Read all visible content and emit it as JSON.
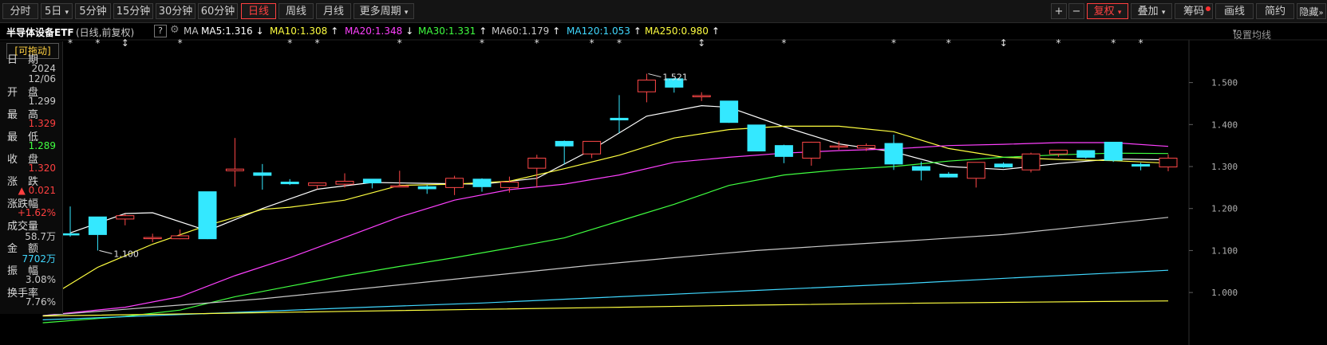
{
  "toolbar": {
    "periods": [
      "分时",
      "5日",
      "5分钟",
      "15分钟",
      "30分钟",
      "60分钟",
      "日线",
      "周线",
      "月线",
      "更多周期"
    ],
    "active_period": "日线",
    "right_buttons": [
      "复权",
      "叠加",
      "筹码",
      "画线",
      "简约",
      "隐藏"
    ],
    "plus": "+",
    "minus": "−",
    "dropdown_icon": "caret-down-icon",
    "hide_icon": "double-chevron-right-icon"
  },
  "header": {
    "name": "半导体设备ETF",
    "mode": "(日线,前复权)",
    "help": "?",
    "ma_label": "MA",
    "settings_link": "设置均线",
    "ma_items": [
      {
        "text": "MA5:1.316",
        "arrow": "↓",
        "color": "#ffffff"
      },
      {
        "text": "MA10:1.308",
        "arrow": "↑",
        "color": "#ffff40"
      },
      {
        "text": "MA20:1.348",
        "arrow": "↓",
        "color": "#ff40ff"
      },
      {
        "text": "MA30:1.331",
        "arrow": "↑",
        "color": "#40ff40"
      },
      {
        "text": "MA60:1.179",
        "arrow": "↑",
        "color": "#c8c8c8"
      },
      {
        "text": "MA120:1.053",
        "arrow": "↑",
        "color": "#40d8ff"
      },
      {
        "text": "MA250:0.980",
        "arrow": "↑",
        "color": "#ffff40"
      }
    ]
  },
  "panel": {
    "header": "[可拖动]",
    "rows": [
      {
        "label": "日　期",
        "value": "2024",
        "color": "#c8c8c8"
      },
      {
        "label": "",
        "value": "12/06",
        "color": "#c8c8c8"
      },
      {
        "label": "开　盘",
        "value": "1.299",
        "color": "#c8c8c8"
      },
      {
        "label": "最　高",
        "value": "1.329",
        "color": "#ff4040"
      },
      {
        "label": "最　低",
        "value": "1.289",
        "color": "#40ff40"
      },
      {
        "label": "收　盘",
        "value": "1.320",
        "color": "#ff4040"
      },
      {
        "label": "涨　跌",
        "value": "▲ 0.021",
        "color": "#ff4040"
      },
      {
        "label": "涨跌幅",
        "value": "+1.62%",
        "color": "#ff4040"
      },
      {
        "label": "成交量",
        "value": "58.7万",
        "color": "#c8c8c8"
      },
      {
        "label": "金　额",
        "value": "7702万",
        "color": "#40d8ff"
      },
      {
        "label": "振　幅",
        "value": "3.08%",
        "color": "#c8c8c8"
      },
      {
        "label": "换手率",
        "value": "7.76%",
        "color": "#c8c8c8"
      }
    ]
  },
  "chart_data": {
    "type": "candlestick",
    "ylim": [
      0.93,
      1.56
    ],
    "yticks": [
      "1.500",
      "1.400",
      "1.300",
      "1.200",
      "1.100",
      "1.000"
    ],
    "ytick_values": [
      1.5,
      1.4,
      1.3,
      1.2,
      1.1,
      1.0
    ],
    "annotations": [
      {
        "text": "1.521",
        "index": 21,
        "value": 1.521
      },
      {
        "text": "1.100",
        "index": 1,
        "value": 1.1
      }
    ],
    "markers": [
      "*",
      "*",
      "↕",
      "*",
      "*",
      "*",
      "*",
      "*",
      "*",
      "*",
      "*",
      "↕",
      "*",
      "*",
      "*",
      "↕",
      "*",
      "*",
      "*"
    ],
    "marker_indices": [
      0,
      1,
      2,
      4,
      8,
      9,
      12,
      15,
      17,
      19,
      20,
      23,
      26,
      30,
      32,
      34,
      36,
      38,
      39
    ],
    "candles": [
      {
        "o": 1.14,
        "h": 1.205,
        "l": 1.133,
        "c": 1.137
      },
      {
        "o": 1.18,
        "h": 1.18,
        "l": 1.1,
        "c": 1.138
      },
      {
        "o": 1.175,
        "h": 1.187,
        "l": 1.16,
        "c": 1.183
      },
      {
        "o": 1.131,
        "h": 1.14,
        "l": 1.12,
        "c": 1.131
      },
      {
        "o": 1.128,
        "h": 1.15,
        "l": 1.127,
        "c": 1.135
      },
      {
        "o": 1.24,
        "h": 1.24,
        "l": 1.127,
        "c": 1.128
      },
      {
        "o": 1.29,
        "h": 1.368,
        "l": 1.252,
        "c": 1.294
      },
      {
        "o": 1.285,
        "h": 1.306,
        "l": 1.245,
        "c": 1.279
      },
      {
        "o": 1.263,
        "h": 1.27,
        "l": 1.256,
        "c": 1.259
      },
      {
        "o": 1.255,
        "h": 1.262,
        "l": 1.246,
        "c": 1.261
      },
      {
        "o": 1.258,
        "h": 1.284,
        "l": 1.25,
        "c": 1.265
      },
      {
        "o": 1.27,
        "h": 1.27,
        "l": 1.248,
        "c": 1.261
      },
      {
        "o": 1.254,
        "h": 1.29,
        "l": 1.251,
        "c": 1.254
      },
      {
        "o": 1.252,
        "h": 1.256,
        "l": 1.235,
        "c": 1.247
      },
      {
        "o": 1.25,
        "h": 1.278,
        "l": 1.232,
        "c": 1.272
      },
      {
        "o": 1.27,
        "h": 1.272,
        "l": 1.24,
        "c": 1.252
      },
      {
        "o": 1.25,
        "h": 1.276,
        "l": 1.238,
        "c": 1.263
      },
      {
        "o": 1.296,
        "h": 1.328,
        "l": 1.25,
        "c": 1.32
      },
      {
        "o": 1.36,
        "h": 1.362,
        "l": 1.305,
        "c": 1.349
      },
      {
        "o": 1.33,
        "h": 1.36,
        "l": 1.32,
        "c": 1.36
      },
      {
        "o": 1.415,
        "h": 1.47,
        "l": 1.38,
        "c": 1.411
      },
      {
        "o": 1.478,
        "h": 1.521,
        "l": 1.453,
        "c": 1.506
      },
      {
        "o": 1.509,
        "h": 1.511,
        "l": 1.476,
        "c": 1.489
      },
      {
        "o": 1.466,
        "h": 1.477,
        "l": 1.456,
        "c": 1.469
      },
      {
        "o": 1.456,
        "h": 1.456,
        "l": 1.404,
        "c": 1.405
      },
      {
        "o": 1.399,
        "h": 1.399,
        "l": 1.336,
        "c": 1.337
      },
      {
        "o": 1.35,
        "h": 1.352,
        "l": 1.308,
        "c": 1.324
      },
      {
        "o": 1.32,
        "h": 1.359,
        "l": 1.302,
        "c": 1.358
      },
      {
        "o": 1.348,
        "h": 1.36,
        "l": 1.34,
        "c": 1.349
      },
      {
        "o": 1.344,
        "h": 1.355,
        "l": 1.337,
        "c": 1.35
      },
      {
        "o": 1.355,
        "h": 1.376,
        "l": 1.292,
        "c": 1.306
      },
      {
        "o": 1.3,
        "h": 1.312,
        "l": 1.267,
        "c": 1.291
      },
      {
        "o": 1.282,
        "h": 1.287,
        "l": 1.274,
        "c": 1.275
      },
      {
        "o": 1.272,
        "h": 1.308,
        "l": 1.25,
        "c": 1.31
      },
      {
        "o": 1.306,
        "h": 1.31,
        "l": 1.297,
        "c": 1.299
      },
      {
        "o": 1.292,
        "h": 1.333,
        "l": 1.286,
        "c": 1.33
      },
      {
        "o": 1.33,
        "h": 1.338,
        "l": 1.323,
        "c": 1.339
      },
      {
        "o": 1.338,
        "h": 1.338,
        "l": 1.319,
        "c": 1.322
      },
      {
        "o": 1.358,
        "h": 1.358,
        "l": 1.311,
        "c": 1.315
      },
      {
        "o": 1.305,
        "h": 1.309,
        "l": 1.291,
        "c": 1.301
      },
      {
        "o": 1.299,
        "h": 1.329,
        "l": 1.289,
        "c": 1.32
      }
    ],
    "ma_lines": [
      {
        "name": "MA5",
        "color": "#ffffff",
        "points": [
          [
            0,
            1.142
          ],
          [
            2,
            1.188
          ],
          [
            3,
            1.19
          ],
          [
            5,
            1.147
          ],
          [
            7,
            1.2
          ],
          [
            9,
            1.246
          ],
          [
            11,
            1.262
          ],
          [
            13,
            1.26
          ],
          [
            15,
            1.258
          ],
          [
            17,
            1.272
          ],
          [
            19,
            1.34
          ],
          [
            21,
            1.42
          ],
          [
            23,
            1.445
          ],
          [
            24,
            1.441
          ],
          [
            26,
            1.395
          ],
          [
            28,
            1.354
          ],
          [
            30,
            1.335
          ],
          [
            32,
            1.3
          ],
          [
            34,
            1.293
          ],
          [
            36,
            1.307
          ],
          [
            38,
            1.318
          ],
          [
            40,
            1.316
          ]
        ]
      },
      {
        "name": "MA10",
        "color": "#ffff40",
        "points": [
          [
            -0.5,
            1.0
          ],
          [
            1,
            1.06
          ],
          [
            3,
            1.115
          ],
          [
            5,
            1.16
          ],
          [
            7,
            1.198
          ],
          [
            8,
            1.203
          ],
          [
            10,
            1.22
          ],
          [
            12,
            1.255
          ],
          [
            14,
            1.258
          ],
          [
            16,
            1.265
          ],
          [
            18,
            1.295
          ],
          [
            20,
            1.327
          ],
          [
            22,
            1.368
          ],
          [
            24,
            1.388
          ],
          [
            26,
            1.396
          ],
          [
            28,
            1.396
          ],
          [
            30,
            1.383
          ],
          [
            32,
            1.343
          ],
          [
            34,
            1.322
          ],
          [
            36,
            1.317
          ],
          [
            38,
            1.314
          ],
          [
            40,
            1.308
          ]
        ]
      },
      {
        "name": "MA20",
        "color": "#ff40ff",
        "points": [
          [
            -1,
            0.945
          ],
          [
            2,
            0.965
          ],
          [
            4,
            0.99
          ],
          [
            6,
            1.04
          ],
          [
            8,
            1.083
          ],
          [
            10,
            1.131
          ],
          [
            12,
            1.18
          ],
          [
            14,
            1.22
          ],
          [
            16,
            1.245
          ],
          [
            18,
            1.258
          ],
          [
            20,
            1.28
          ],
          [
            22,
            1.31
          ],
          [
            24,
            1.322
          ],
          [
            26,
            1.332
          ],
          [
            28,
            1.338
          ],
          [
            30,
            1.342
          ],
          [
            32,
            1.35
          ],
          [
            34,
            1.353
          ],
          [
            36,
            1.357
          ],
          [
            38,
            1.357
          ],
          [
            40,
            1.348
          ]
        ]
      },
      {
        "name": "MA30",
        "color": "#40ff40",
        "points": [
          [
            -1,
            0.928
          ],
          [
            2,
            0.943
          ],
          [
            4,
            0.958
          ],
          [
            6,
            0.99
          ],
          [
            8,
            1.015
          ],
          [
            10,
            1.04
          ],
          [
            12,
            1.062
          ],
          [
            14,
            1.083
          ],
          [
            16,
            1.106
          ],
          [
            18,
            1.13
          ],
          [
            20,
            1.17
          ],
          [
            22,
            1.21
          ],
          [
            24,
            1.255
          ],
          [
            26,
            1.28
          ],
          [
            28,
            1.292
          ],
          [
            30,
            1.3
          ],
          [
            32,
            1.313
          ],
          [
            34,
            1.322
          ],
          [
            36,
            1.328
          ],
          [
            38,
            1.332
          ],
          [
            40,
            1.331
          ]
        ]
      },
      {
        "name": "MA60",
        "color": "#c8c8c8",
        "points": [
          [
            -1,
            0.945
          ],
          [
            2,
            0.96
          ],
          [
            4,
            0.97
          ],
          [
            7,
            0.985
          ],
          [
            10,
            1.005
          ],
          [
            13,
            1.025
          ],
          [
            16,
            1.045
          ],
          [
            19,
            1.065
          ],
          [
            22,
            1.083
          ],
          [
            25,
            1.1
          ],
          [
            28,
            1.113
          ],
          [
            31,
            1.125
          ],
          [
            34,
            1.138
          ],
          [
            37,
            1.158
          ],
          [
            40,
            1.179
          ]
        ]
      },
      {
        "name": "MA120",
        "color": "#40d8ff",
        "points": [
          [
            -1,
            0.935
          ],
          [
            5,
            0.95
          ],
          [
            10,
            0.963
          ],
          [
            15,
            0.975
          ],
          [
            20,
            0.99
          ],
          [
            25,
            1.005
          ],
          [
            30,
            1.02
          ],
          [
            35,
            1.037
          ],
          [
            40,
            1.053
          ]
        ]
      },
      {
        "name": "MA250",
        "color": "#ffff40",
        "points": [
          [
            -1,
            0.944
          ],
          [
            5,
            0.95
          ],
          [
            10,
            0.955
          ],
          [
            15,
            0.96
          ],
          [
            20,
            0.965
          ],
          [
            25,
            0.97
          ],
          [
            30,
            0.974
          ],
          [
            35,
            0.977
          ],
          [
            40,
            0.98
          ]
        ]
      }
    ]
  }
}
